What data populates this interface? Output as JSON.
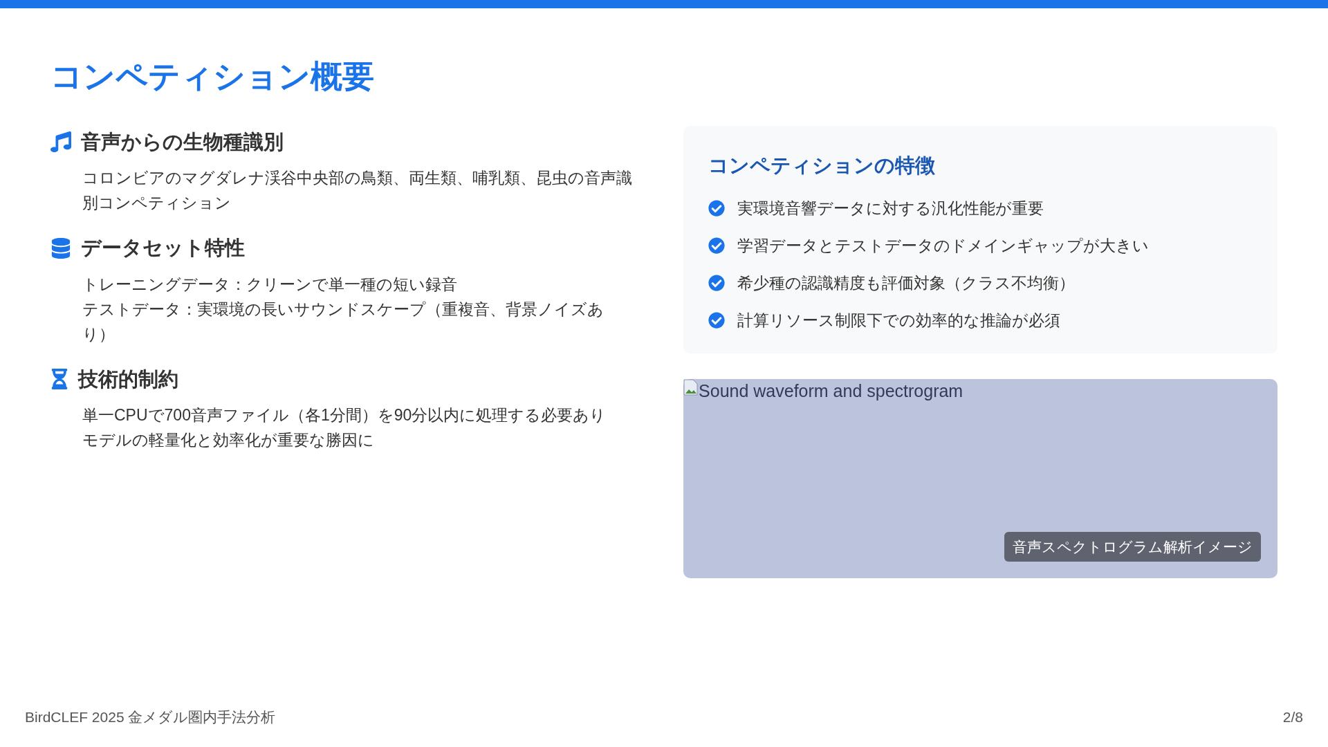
{
  "title": "コンペティション概要",
  "sections": [
    {
      "kind": "music",
      "heading": "音声からの生物種識別",
      "lines": [
        "コロンビアのマグダレナ渓谷中央部の鳥類、両生類、哺乳類、昆虫の音声識別コンペティション"
      ]
    },
    {
      "kind": "database",
      "heading": "データセット特性",
      "lines": [
        "トレーニングデータ：クリーンで単一種の短い録音",
        "テストデータ：実環境の長いサウンドスケープ（重複音、背景ノイズあり）"
      ]
    },
    {
      "kind": "hourglass",
      "heading": "技術的制約",
      "lines": [
        "単一CPUで700音声ファイル（各1分間）を90分以内に処理する必要あり",
        "モデルの軽量化と効率化が重要な勝因に"
      ]
    }
  ],
  "features": {
    "title": "コンペティションの特徴",
    "items": [
      "実環境音響データに対する汎化性能が重要",
      "学習データとテストデータのドメインギャップが大きい",
      "希少種の認識精度も評価対象（クラス不均衡）",
      "計算リソース制限下での効率的な推論が必須"
    ]
  },
  "image": {
    "alt": "Sound waveform and spectrogram",
    "caption": "音声スペクトログラム解析イメージ"
  },
  "footer": {
    "left": "BirdCLEF 2025 金メダル圏内手法分析",
    "page": "2/8"
  }
}
